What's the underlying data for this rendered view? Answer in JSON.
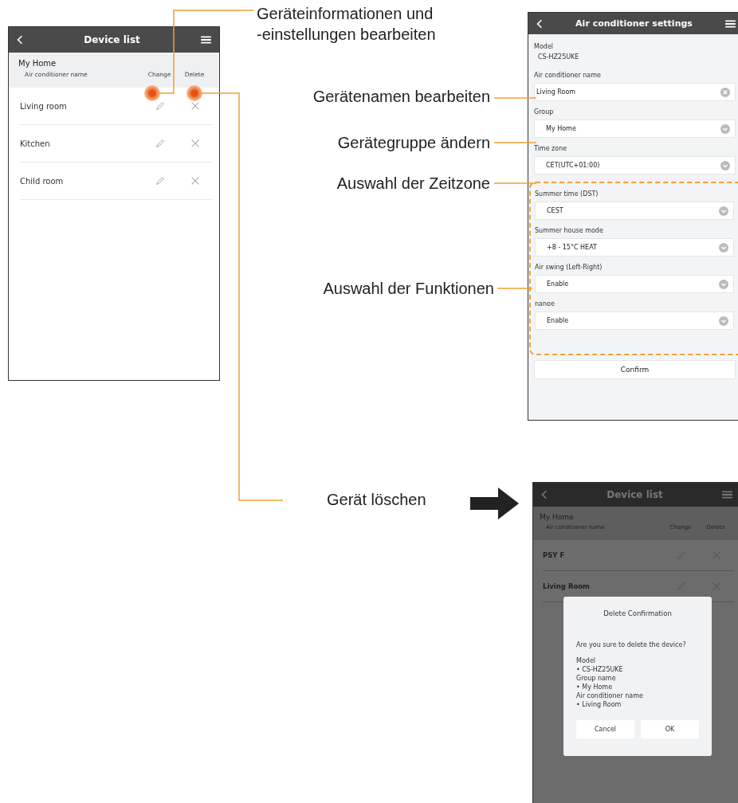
{
  "device_list_screen": {
    "title": "Device list",
    "group": "My Home",
    "columns": [
      "Air conditioner name",
      "Change",
      "Delete"
    ],
    "rows": [
      {
        "name": "Living room"
      },
      {
        "name": "Kitchen"
      },
      {
        "name": "Child room"
      }
    ]
  },
  "settings_screen": {
    "title": "Air conditioner settings",
    "model_label": "Model",
    "model": "CS-HZ25UKE",
    "fields": [
      {
        "label": "Air conditioner name",
        "value": "Living Room",
        "kind": "text"
      },
      {
        "label": "Group",
        "value": "My Home",
        "kind": "select"
      },
      {
        "label": "Time zone",
        "value": "CET(UTC+01:00)",
        "kind": "select"
      }
    ],
    "function_fields": [
      {
        "label": "Summer time (DST)",
        "value": "CEST",
        "kind": "select"
      },
      {
        "label": "Summer house mode",
        "value": "+8 - 15°C HEAT",
        "kind": "select"
      },
      {
        "label": "Air swing (Left-Right)",
        "value": "Enable",
        "kind": "select"
      },
      {
        "label": "nanoe",
        "value": "Enable",
        "kind": "select"
      }
    ],
    "confirm": "Confirm"
  },
  "delete_screen": {
    "title": "Device list",
    "group": "My Home",
    "columns": [
      "Air conditioner name",
      "Change",
      "Delete"
    ],
    "rows": [
      {
        "name": "PSY F"
      },
      {
        "name": "Living Room"
      }
    ],
    "dialog": {
      "title": "Delete Confirmation",
      "message": "Are you sure to delete the device?",
      "details": [
        {
          "label": "Model",
          "value": "• CS-HZ25UKE"
        },
        {
          "label": "Group name",
          "value": "• My Home"
        },
        {
          "label": "Air conditioner name",
          "value": "• Living Room"
        }
      ],
      "buttons": [
        "Cancel",
        "OK"
      ]
    }
  },
  "annotations": [
    {
      "lines": [
        "Geräteinformationen und",
        "-einstellungen bearbeiten"
      ]
    },
    {
      "lines": [
        "Gerätenamen bearbeiten"
      ]
    },
    {
      "lines": [
        "Gerätegruppe ändern"
      ]
    },
    {
      "lines": [
        "Auswahl der Zeitzone"
      ]
    },
    {
      "lines": [
        "Auswahl der Funktionen"
      ]
    },
    {
      "lines": [
        "Gerät löschen"
      ]
    }
  ]
}
